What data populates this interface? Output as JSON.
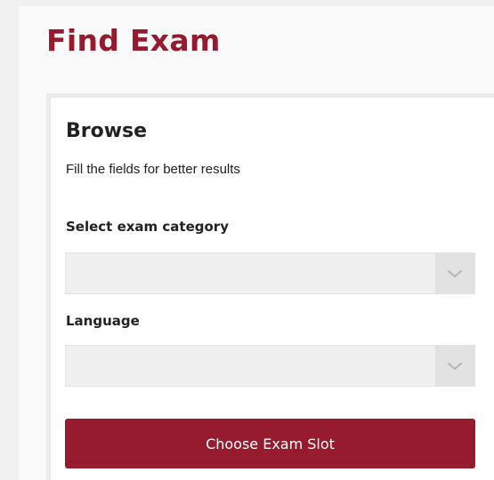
{
  "page": {
    "title": "Find Exam"
  },
  "browse": {
    "heading": "Browse",
    "subtitle": "Fill the fields for better results",
    "fields": [
      {
        "label": "Select exam category",
        "value": "",
        "icon": "chevron-down-icon"
      },
      {
        "label": "Language",
        "value": "",
        "icon": "chevron-down-icon"
      }
    ],
    "submit_label": "Choose Exam Slot"
  },
  "colors": {
    "accent": "#971b2f",
    "select_bg": "#f0f0f0",
    "arrow_bg": "#e2e2e2",
    "page_bg": "#f1f1f1"
  }
}
